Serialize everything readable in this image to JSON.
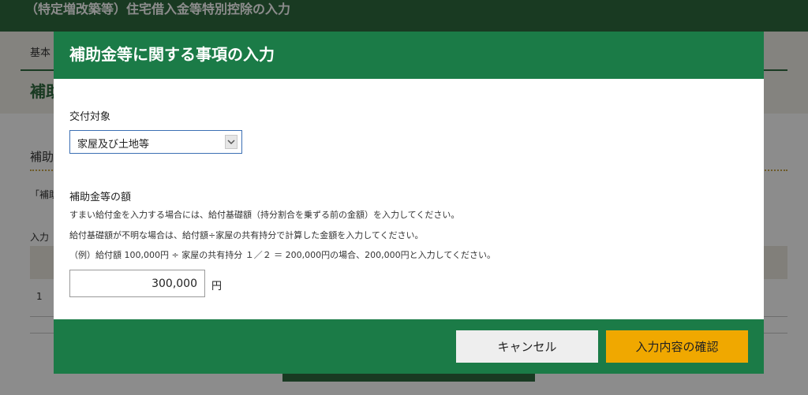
{
  "background": {
    "header_title": "（特定増改築等）住宅借入金等特別控除の入力",
    "breadcrumb": "基本",
    "band_title": "補助",
    "section_title": "補助",
    "note": "「補助",
    "caption": "入力",
    "row_number": "1"
  },
  "modal": {
    "title": "補助金等に関する事項の入力",
    "target_label": "交付対象",
    "target_select": {
      "value": "家屋及び土地等"
    },
    "amount_label": "補助金等の額",
    "descriptions": [
      "すまい給付金を入力する場合には、給付基礎額（持分割合を乗ずる前の金額）を入力してください。",
      "給付基礎額が不明な場合は、給付額÷家屋の共有持分で計算した金額を入力してください。",
      "（例）給付額 100,000円 ÷ 家屋の共有持分 １／２ ＝ 200,000円の場合、200,000円と入力してください。"
    ],
    "amount_value": "300,000",
    "amount_unit": "円",
    "cancel_label": "キャンセル",
    "confirm_label": "入力内容の確認"
  },
  "colors": {
    "header_green": "#2f6a3f",
    "modal_green": "#1b7b47",
    "confirm_yellow": "#f0a800",
    "cancel_gray": "#eeeeee"
  },
  "icons": {
    "select_arrow": "chevron-down-icon"
  }
}
